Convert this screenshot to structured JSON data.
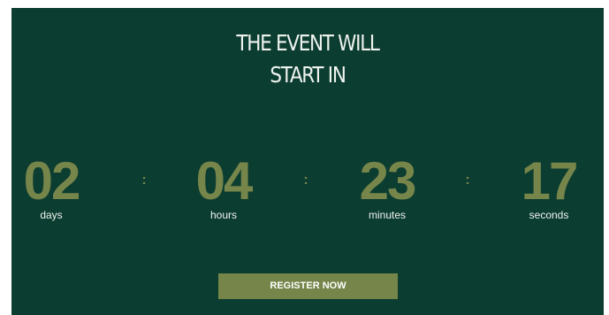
{
  "heading": {
    "line1": "THE EVENT WILL",
    "line2": "START IN"
  },
  "countdown": {
    "days": {
      "value": "02",
      "label": "days"
    },
    "hours": {
      "value": "04",
      "label": "hours"
    },
    "minutes": {
      "value": "23",
      "label": "minutes"
    },
    "seconds": {
      "value": "17",
      "label": "seconds"
    },
    "separator": ":"
  },
  "cta": {
    "label": "REGISTER NOW"
  },
  "colors": {
    "background": "#0c3d31",
    "accent": "#76854a",
    "text": "#eef3ee"
  }
}
